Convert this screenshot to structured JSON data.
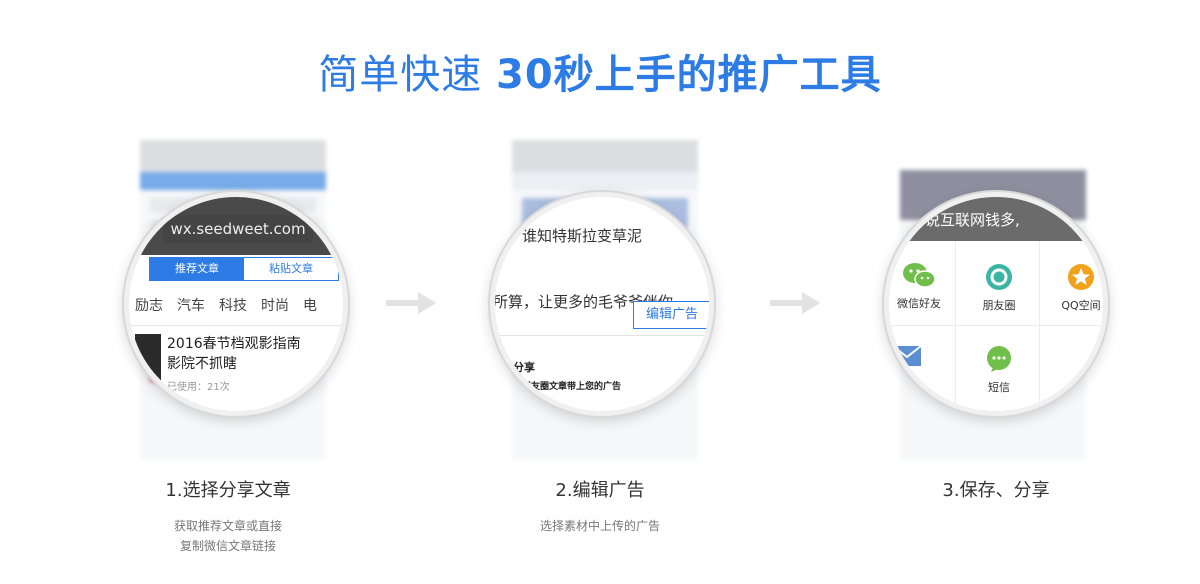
{
  "headline": {
    "light": "简单快速",
    "strong": "30秒上手的推广工具"
  },
  "colors": {
    "accent": "#2d7be5",
    "wechat": "#6fbf4a",
    "moments": "#3bb6a5",
    "qzone": "#f2a11b"
  },
  "steps": [
    {
      "title": "1.选择分享文章",
      "desc_line1": "获取推荐文章或直接",
      "desc_line2": "复制微信文章链接",
      "lens": {
        "url": "wx.seedweet.com",
        "tab_recommend": "推荐文章",
        "tab_paste": "粘贴文章",
        "categories": [
          "励志",
          "汽车",
          "科技",
          "时尚",
          "电"
        ],
        "article_title": "2016春节档观影指南 影院不抓瞎",
        "article_meta": "已使用：21次"
      }
    },
    {
      "title": "2.编辑广告",
      "desc_line1": "选择素材中上传的广告",
      "lens": {
        "line1": "，谁知特斯拉变草泥",
        "line2": "所算，让更多的毛爷爷伴你",
        "edit_button": "编辑广告",
        "section_heading": "分享",
        "section_sub": "到朋友圈文章带上您的广告"
      }
    },
    {
      "title": "3.保存、分享",
      "lens": {
        "banner_text": "说互联网钱多,",
        "share_wechat": "微信好友",
        "share_moments": "朋友圈",
        "share_qzone": "QQ空间",
        "share_sms": "短信"
      }
    }
  ]
}
